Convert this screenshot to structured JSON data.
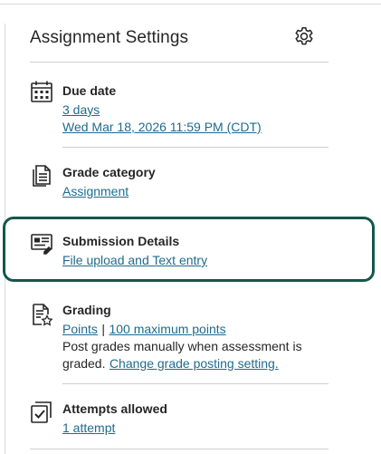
{
  "panel": {
    "title": "Assignment Settings"
  },
  "sections": {
    "due_date": {
      "title": "Due date",
      "relative": "3 days",
      "absolute": "Wed Mar 18, 2026 11:59 PM (CDT)",
      "icon": "calendar-icon"
    },
    "grade_category": {
      "title": "Grade category",
      "value": "Assignment",
      "icon": "document-icon"
    },
    "submission_details": {
      "title": "Submission Details",
      "value": "File upload and Text entry",
      "icon": "form-icon",
      "highlight_color": "#14574a"
    },
    "grading": {
      "title": "Grading",
      "scheme": "Points",
      "separator": "|",
      "max_points": "100 maximum points",
      "note_line1": "Post grades manually when assessment is",
      "note_line2": "graded.",
      "change_link": "Change grade posting setting.",
      "icon": "grading-star-icon"
    },
    "attempts": {
      "title": "Attempts allowed",
      "value": "1 attempt",
      "icon": "checkbox-stack-icon"
    }
  },
  "colors": {
    "link": "#1f6b8e",
    "text": "#262626",
    "divider": "#cfcfcf"
  },
  "icons": {
    "settings": "gear-icon"
  }
}
